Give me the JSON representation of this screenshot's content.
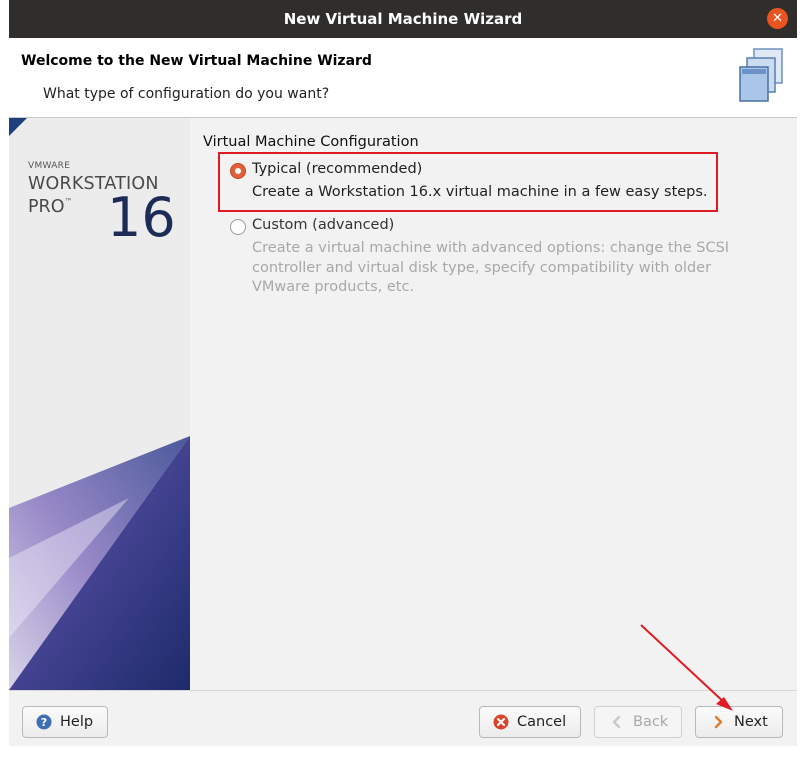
{
  "window": {
    "title": "New Virtual Machine Wizard",
    "close_glyph": "✕"
  },
  "header": {
    "title": "Welcome to the New Virtual Machine Wizard",
    "subtitle": "What type of configuration do you want?",
    "icon": "windows-stack-icon"
  },
  "brand": {
    "vendor": "VMWARE",
    "product": "WORKSTATION",
    "edition": "PRO",
    "tm": "™",
    "version": "16"
  },
  "config": {
    "section_title": "Virtual Machine Configuration",
    "options": [
      {
        "label": "Typical (recommended)",
        "description": "Create a Workstation 16.x virtual machine in a few easy steps.",
        "selected": true
      },
      {
        "label": "Custom (advanced)",
        "description_lines": [
          "Create a virtual machine with advanced options: change the SCSI",
          "controller and virtual disk type, specify compatibility with older",
          "VMware products, etc."
        ],
        "selected": false
      }
    ]
  },
  "footer": {
    "help_label": "Help",
    "cancel_label": "Cancel",
    "back_label": "Back",
    "next_label": "Next"
  },
  "colors": {
    "accent": "#e95420",
    "highlight": "#e01b24",
    "brand_dark": "#1d2b57"
  }
}
